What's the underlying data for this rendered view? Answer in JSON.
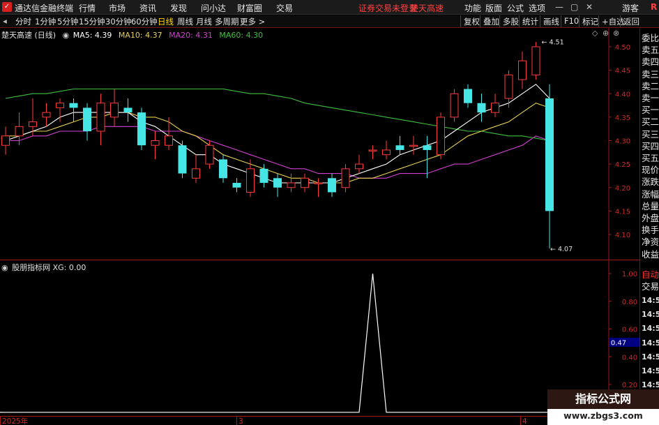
{
  "app": {
    "title": "通达信金融终端",
    "menus": [
      "行情",
      "市场",
      "资讯",
      "发现",
      "问小达",
      "财富圈",
      "交易"
    ],
    "notice_login": "证券交易未登录",
    "notice_stock": "楚天高速",
    "right_menus": [
      "功能",
      "版面",
      "公式",
      "选项"
    ],
    "user": "游客"
  },
  "toolbar": {
    "periods": [
      "分时",
      "1分钟",
      "5分钟",
      "15分钟",
      "30分钟",
      "60分钟",
      "日线",
      "周线",
      "月线",
      "多周期",
      "更多 >"
    ],
    "active_period": "日线",
    "right_buttons": [
      "复权",
      "叠加",
      "多股",
      "统计",
      "画线",
      "F10",
      "标记",
      "+自选",
      "返回"
    ]
  },
  "main_chart": {
    "stock_label": "楚天高速 (日线)",
    "ma5": "MA5: 4.39",
    "ma10": "MA10: 4.37",
    "ma20": "MA20: 4.31",
    "ma60": "MA60: 4.30",
    "high_label": "4.51",
    "low_label": "4.07"
  },
  "indicator": {
    "label": "股朋指标网 XG: 0.00",
    "crosshair_value": "0.47"
  },
  "side_panel": {
    "main_items": [
      "委比",
      "卖五",
      "卖四",
      "卖三",
      "卖二",
      "卖一",
      "买一",
      "买二",
      "买三",
      "买四",
      "买五",
      "现价",
      "涨跌",
      "涨幅",
      "总量",
      "外盘",
      "换手",
      "净资",
      "收益"
    ],
    "auto_label": "自动",
    "trade_label": "交易",
    "times": [
      "14:56",
      "14:56",
      "14:56",
      "14:56",
      "14:56",
      "14:56",
      "14:56",
      "14:56",
      "14:56"
    ]
  },
  "x_axis": {
    "labels": [
      "2025年",
      "3",
      "4"
    ]
  },
  "watermark": {
    "line1": "指标公式网",
    "line2": "www.zbgs3.com"
  },
  "colors": {
    "up": "#ff3b3b",
    "down": "#46e6e6",
    "ma5": "#ffffff",
    "ma10": "#e8d050",
    "ma20": "#d23fd2",
    "ma60": "#3fbf3f",
    "axis_red": "#a01818"
  },
  "chart_data": {
    "type": "candlestick",
    "y_axis_ticks": [
      4.5,
      4.45,
      4.4,
      4.35,
      4.3,
      4.25,
      4.2,
      4.15,
      4.1
    ],
    "ylim": [
      4.06,
      4.53
    ],
    "candles": [
      {
        "o": 4.29,
        "c": 4.31,
        "h": 4.33,
        "l": 4.27
      },
      {
        "o": 4.31,
        "c": 4.33,
        "h": 4.36,
        "l": 4.29
      },
      {
        "o": 4.33,
        "c": 4.34,
        "h": 4.39,
        "l": 4.31
      },
      {
        "o": 4.35,
        "c": 4.36,
        "h": 4.38,
        "l": 4.33
      },
      {
        "o": 4.37,
        "c": 4.38,
        "h": 4.39,
        "l": 4.34
      },
      {
        "o": 4.38,
        "c": 4.37,
        "h": 4.39,
        "l": 4.34
      },
      {
        "o": 4.37,
        "c": 4.32,
        "h": 4.38,
        "l": 4.3
      },
      {
        "o": 4.32,
        "c": 4.38,
        "h": 4.4,
        "l": 4.29
      },
      {
        "o": 4.35,
        "c": 4.38,
        "h": 4.41,
        "l": 4.33
      },
      {
        "o": 4.37,
        "c": 4.36,
        "h": 4.39,
        "l": 4.34
      },
      {
        "o": 4.36,
        "c": 4.29,
        "h": 4.37,
        "l": 4.28
      },
      {
        "o": 4.29,
        "c": 4.3,
        "h": 4.32,
        "l": 4.26
      },
      {
        "o": 4.29,
        "c": 4.31,
        "h": 4.35,
        "l": 4.28
      },
      {
        "o": 4.29,
        "c": 4.23,
        "h": 4.3,
        "l": 4.22
      },
      {
        "o": 4.22,
        "c": 4.24,
        "h": 4.27,
        "l": 4.21
      },
      {
        "o": 4.25,
        "c": 4.29,
        "h": 4.3,
        "l": 4.24
      },
      {
        "o": 4.26,
        "c": 4.22,
        "h": 4.27,
        "l": 4.21
      },
      {
        "o": 4.21,
        "c": 4.2,
        "h": 4.22,
        "l": 4.19
      },
      {
        "o": 4.19,
        "c": 4.24,
        "h": 4.26,
        "l": 4.18
      },
      {
        "o": 4.24,
        "c": 4.21,
        "h": 4.25,
        "l": 4.2
      },
      {
        "o": 4.22,
        "c": 4.2,
        "h": 4.23,
        "l": 4.18
      },
      {
        "o": 4.2,
        "c": 4.21,
        "h": 4.23,
        "l": 4.19
      },
      {
        "o": 4.2,
        "c": 4.22,
        "h": 4.23,
        "l": 4.19
      },
      {
        "o": 4.21,
        "c": 4.21,
        "h": 4.22,
        "l": 4.18
      },
      {
        "o": 4.22,
        "c": 4.19,
        "h": 4.23,
        "l": 4.18
      },
      {
        "o": 4.2,
        "c": 4.24,
        "h": 4.25,
        "l": 4.19
      },
      {
        "o": 4.24,
        "c": 4.25,
        "h": 4.27,
        "l": 4.23
      },
      {
        "o": 4.28,
        "c": 4.28,
        "h": 4.29,
        "l": 4.26
      },
      {
        "o": 4.27,
        "c": 4.28,
        "h": 4.3,
        "l": 4.26
      },
      {
        "o": 4.29,
        "c": 4.28,
        "h": 4.31,
        "l": 4.27
      },
      {
        "o": 4.29,
        "c": 4.29,
        "h": 4.31,
        "l": 4.27
      },
      {
        "o": 4.29,
        "c": 4.28,
        "h": 4.31,
        "l": 4.22
      },
      {
        "o": 4.27,
        "c": 4.35,
        "h": 4.36,
        "l": 4.26
      },
      {
        "o": 4.35,
        "c": 4.4,
        "h": 4.41,
        "l": 4.34
      },
      {
        "o": 4.41,
        "c": 4.38,
        "h": 4.42,
        "l": 4.37
      },
      {
        "o": 4.38,
        "c": 4.36,
        "h": 4.4,
        "l": 4.34
      },
      {
        "o": 4.36,
        "c": 4.38,
        "h": 4.4,
        "l": 4.35
      },
      {
        "o": 4.39,
        "c": 4.44,
        "h": 4.45,
        "l": 4.37
      },
      {
        "o": 4.43,
        "c": 4.47,
        "h": 4.49,
        "l": 4.41
      },
      {
        "o": 4.44,
        "c": 4.5,
        "h": 4.51,
        "l": 4.43
      },
      {
        "o": 4.39,
        "c": 4.15,
        "h": 4.42,
        "l": 4.07
      }
    ],
    "ma5": [
      4.3,
      4.31,
      4.32,
      4.33,
      4.35,
      4.36,
      4.36,
      4.36,
      4.36,
      4.36,
      4.34,
      4.33,
      4.31,
      4.29,
      4.27,
      4.27,
      4.25,
      4.24,
      4.23,
      4.22,
      4.21,
      4.21,
      4.21,
      4.21,
      4.21,
      4.22,
      4.23,
      4.24,
      4.25,
      4.27,
      4.28,
      4.29,
      4.3,
      4.32,
      4.34,
      4.36,
      4.37,
      4.38,
      4.4,
      4.42,
      4.39
    ],
    "ma10": [
      4.31,
      4.31,
      4.32,
      4.32,
      4.33,
      4.34,
      4.35,
      4.35,
      4.36,
      4.36,
      4.35,
      4.35,
      4.34,
      4.32,
      4.31,
      4.29,
      4.27,
      4.26,
      4.25,
      4.24,
      4.23,
      4.22,
      4.22,
      4.21,
      4.21,
      4.21,
      4.22,
      4.22,
      4.23,
      4.24,
      4.25,
      4.26,
      4.27,
      4.29,
      4.31,
      4.32,
      4.33,
      4.34,
      4.36,
      4.38,
      4.37
    ],
    "ma20": [
      4.3,
      4.3,
      4.31,
      4.31,
      4.32,
      4.32,
      4.32,
      4.33,
      4.33,
      4.33,
      4.33,
      4.32,
      4.32,
      4.32,
      4.31,
      4.3,
      4.29,
      4.28,
      4.27,
      4.26,
      4.25,
      4.24,
      4.24,
      4.23,
      4.23,
      4.23,
      4.22,
      4.22,
      4.22,
      4.23,
      4.23,
      4.23,
      4.24,
      4.25,
      4.25,
      4.26,
      4.27,
      4.28,
      4.29,
      4.31,
      4.3
    ],
    "ma60": [
      4.39,
      4.395,
      4.4,
      4.4,
      4.405,
      4.41,
      4.41,
      4.41,
      4.41,
      4.41,
      4.41,
      4.41,
      4.41,
      4.41,
      4.41,
      4.41,
      4.41,
      4.405,
      4.4,
      4.4,
      4.395,
      4.39,
      4.38,
      4.375,
      4.37,
      4.365,
      4.36,
      4.355,
      4.35,
      4.345,
      4.34,
      4.335,
      4.33,
      4.325,
      4.32,
      4.32,
      4.315,
      4.31,
      4.31,
      4.305,
      4.3
    ],
    "indicator_axis_ticks": [
      1.0,
      0.8,
      0.6,
      0.4,
      0.2
    ],
    "indicator_ylim": [
      -0.02,
      1.04
    ],
    "indicator_xg": [
      0,
      0,
      0,
      0,
      0,
      0,
      0,
      0,
      0,
      0,
      0,
      0,
      0,
      0,
      0,
      0,
      0,
      0,
      0,
      0,
      0,
      0,
      0,
      0,
      0,
      0,
      0,
      1,
      0,
      0,
      0,
      0,
      0,
      0,
      0,
      0,
      0,
      0,
      0,
      0,
      0
    ]
  }
}
